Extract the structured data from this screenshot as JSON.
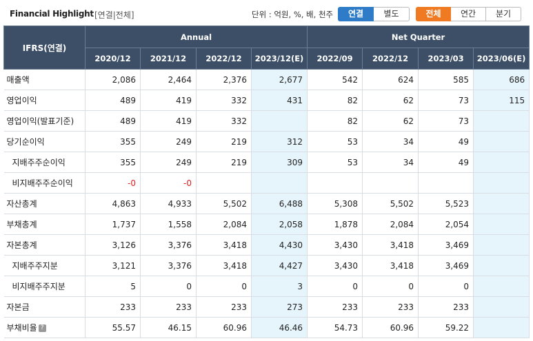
{
  "header": {
    "title": "Financial Highlight",
    "scope": "[연결|전체]",
    "unit": "단위 : 억원, %, 배, 천주",
    "consol_buttons": [
      "연결",
      "별도"
    ],
    "period_buttons": [
      "전체",
      "연간",
      "분기"
    ],
    "active_consol": "연결",
    "active_period": "전체"
  },
  "table": {
    "corner": "IFRS(연결)",
    "group_annual": "Annual",
    "group_quarter": "Net Quarter",
    "columns": [
      "2020/12",
      "2021/12",
      "2022/12",
      "2023/12(E)",
      "2022/09",
      "2022/12",
      "2023/03",
      "2023/06(E)"
    ],
    "estimate_columns": [
      3,
      7
    ],
    "rows": [
      {
        "label": "매출액",
        "indent": false,
        "help": false,
        "values": [
          "2,086",
          "2,464",
          "2,376",
          "2,677",
          "542",
          "624",
          "585",
          "686"
        ]
      },
      {
        "label": "영업이익",
        "indent": false,
        "help": false,
        "values": [
          "489",
          "419",
          "332",
          "431",
          "82",
          "62",
          "73",
          "115"
        ]
      },
      {
        "label": "영업이익(발표기준)",
        "indent": false,
        "help": false,
        "values": [
          "489",
          "419",
          "332",
          "",
          "82",
          "62",
          "73",
          ""
        ]
      },
      {
        "label": "당기순이익",
        "indent": false,
        "help": false,
        "values": [
          "355",
          "249",
          "219",
          "312",
          "53",
          "34",
          "49",
          ""
        ]
      },
      {
        "label": "지배주주순이익",
        "indent": true,
        "help": false,
        "values": [
          "355",
          "249",
          "219",
          "309",
          "53",
          "34",
          "49",
          ""
        ]
      },
      {
        "label": "비지배주주순이익",
        "indent": true,
        "help": false,
        "values": [
          "-0",
          "-0",
          "",
          "",
          "",
          "",
          "",
          ""
        ]
      },
      {
        "label": "자산총계",
        "indent": false,
        "help": false,
        "values": [
          "4,863",
          "4,933",
          "5,502",
          "6,488",
          "5,308",
          "5,502",
          "5,523",
          ""
        ]
      },
      {
        "label": "부채총계",
        "indent": false,
        "help": false,
        "values": [
          "1,737",
          "1,558",
          "2,084",
          "2,058",
          "1,878",
          "2,084",
          "2,054",
          ""
        ]
      },
      {
        "label": "자본총계",
        "indent": false,
        "help": false,
        "values": [
          "3,126",
          "3,376",
          "3,418",
          "4,430",
          "3,430",
          "3,418",
          "3,469",
          ""
        ]
      },
      {
        "label": "지배주주지분",
        "indent": true,
        "help": false,
        "values": [
          "3,121",
          "3,376",
          "3,418",
          "4,427",
          "3,430",
          "3,418",
          "3,469",
          ""
        ]
      },
      {
        "label": "비지배주주지분",
        "indent": true,
        "help": false,
        "values": [
          "5",
          "0",
          "0",
          "3",
          "0",
          "0",
          "0",
          ""
        ]
      },
      {
        "label": "자본금",
        "indent": false,
        "help": false,
        "values": [
          "233",
          "233",
          "233",
          "273",
          "233",
          "233",
          "233",
          ""
        ]
      },
      {
        "label": "부채비율",
        "indent": false,
        "help": true,
        "values": [
          "55.57",
          "46.15",
          "60.96",
          "46.46",
          "54.73",
          "60.96",
          "59.22",
          ""
        ]
      }
    ]
  },
  "colors": {
    "header_bg": "#3c4f66",
    "estimate_bg": "#e6f4fb",
    "active_blue": "#2e7cc7",
    "active_orange": "#f07a22",
    "negative": "#e02020"
  }
}
